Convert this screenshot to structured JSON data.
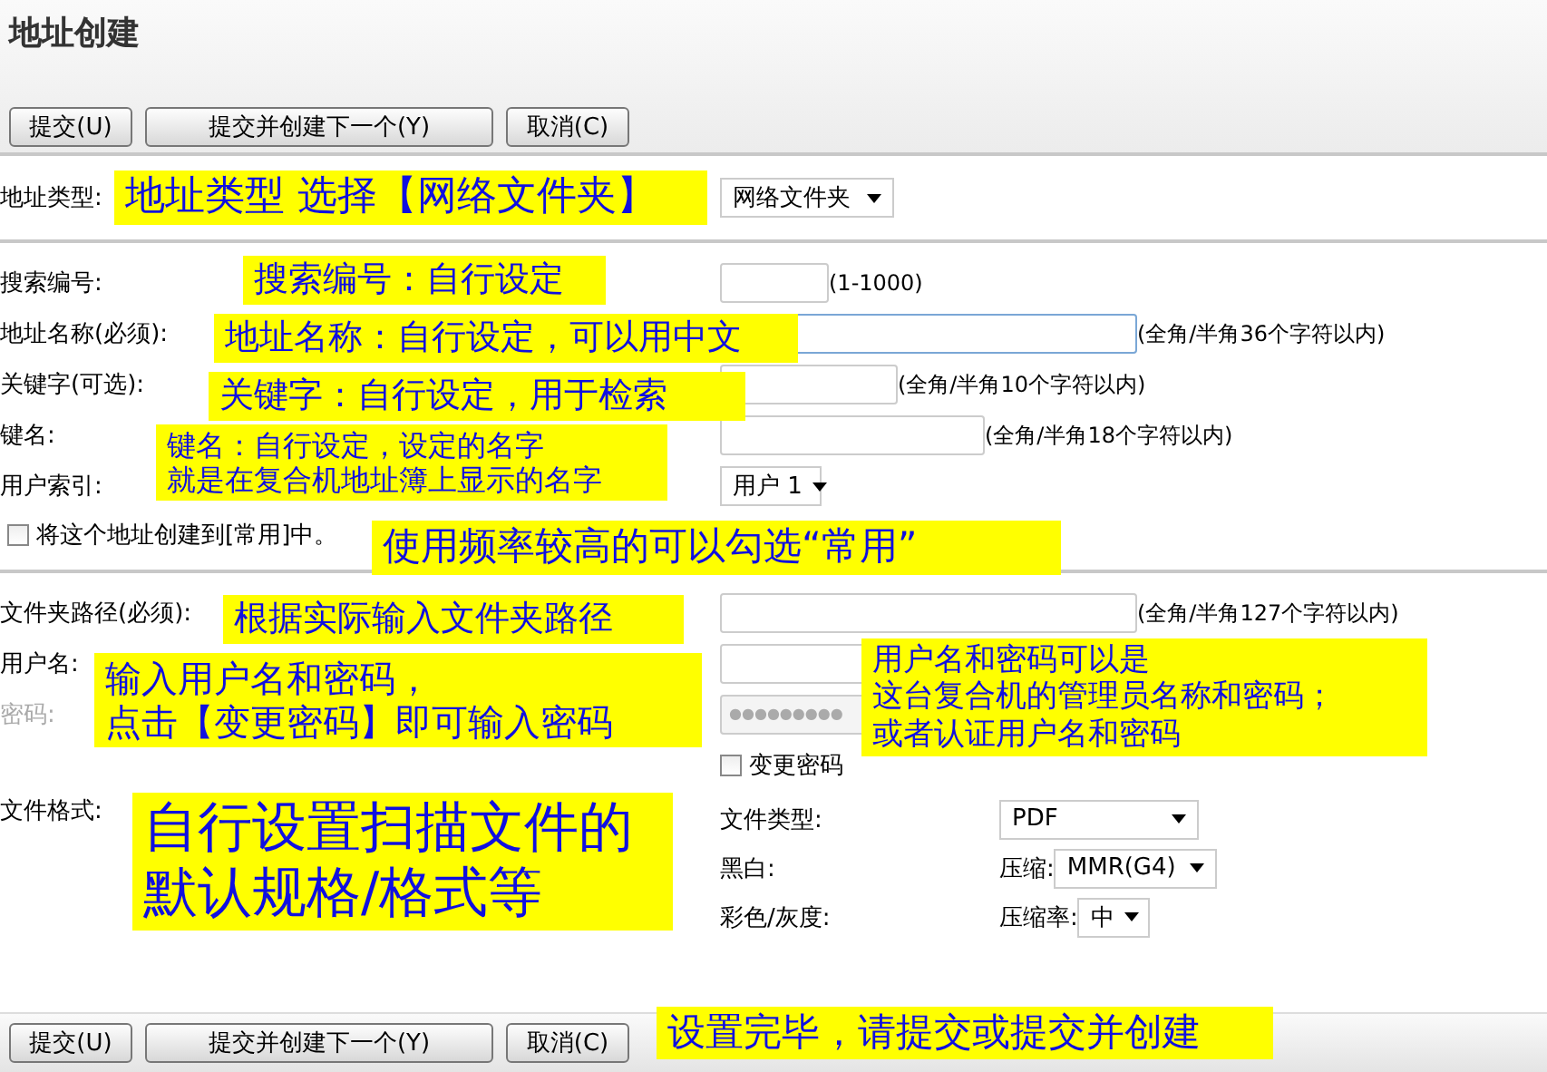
{
  "title": "地址创建",
  "top_buttons": [
    "提交(U)",
    "提交并创建下一个(Y)",
    "取消(C)"
  ],
  "address_type": {
    "label": "地址类型:",
    "value": "网络文件夹"
  },
  "section1": [
    {
      "kind": "text",
      "label": "搜索编号:",
      "hint": "(1-1000)",
      "focused": false
    },
    {
      "kind": "text",
      "label": "地址名称(必须):",
      "hint": "(全角/半角36个字符以内)",
      "focused": true
    },
    {
      "kind": "text",
      "label": "关键字(可选):",
      "hint": "(全角/半角10个字符以内)",
      "focused": false
    },
    {
      "kind": "text",
      "label": "键名:",
      "hint": "(全角/半角18个字符以内)",
      "focused": false
    },
    {
      "kind": "select",
      "label": "用户索引:",
      "value": "用户 1"
    }
  ],
  "favorite": {
    "label": "将这个地址创建到[常用]中。",
    "checked": false
  },
  "section2": [
    {
      "kind": "text",
      "label": "文件夹路径(必须):",
      "hint": "(全角/半角127个字符以内)",
      "disabled": false
    },
    {
      "kind": "text",
      "label": "用户名:",
      "disabled": false
    },
    {
      "kind": "password",
      "label": "密码:",
      "mask": "●●●●●●●●●",
      "disabled": true
    }
  ],
  "change_password": {
    "label": "变更密码",
    "checked": false
  },
  "file_format": {
    "label": "文件格式:",
    "rows": [
      {
        "label": "文件类型:",
        "value": "PDF"
      },
      {
        "label": "黑白:",
        "sublabel": "压缩:",
        "value": "MMR(G4)"
      },
      {
        "label": "彩色/灰度:",
        "sublabel": "压缩率:",
        "value": "中"
      }
    ]
  },
  "bottom_buttons": [
    "提交(U)",
    "提交并创建下一个(Y)",
    "取消(C)"
  ],
  "annotations": [
    {
      "lines": [
        "地址类型  选择【网络文件夹】"
      ]
    },
    {
      "lines": [
        "搜索编号：自行设定"
      ]
    },
    {
      "lines": [
        "地址名称：自行设定，可以用中文"
      ]
    },
    {
      "lines": [
        "关键字：自行设定，用于检索"
      ]
    },
    {
      "lines": [
        "键名：自行设定，设定的名字",
        "就是在复合机地址簿上显示的名字"
      ]
    },
    {
      "lines": [
        "使用频率较高的可以勾选“常用”"
      ]
    },
    {
      "lines": [
        "根据实际输入文件夹路径"
      ]
    },
    {
      "lines": [
        "输入用户名和密码，",
        "点击【变更密码】即可输入密码"
      ]
    },
    {
      "lines": [
        "用户名和密码可以是",
        "这台复合机的管理员名称和密码；",
        "或者认证用户名和密码"
      ]
    },
    {
      "lines": [
        "自行设置扫描文件的",
        "默认规格/格式等"
      ]
    },
    {
      "lines": [
        "设置完毕，请提交或提交并创建"
      ]
    }
  ]
}
